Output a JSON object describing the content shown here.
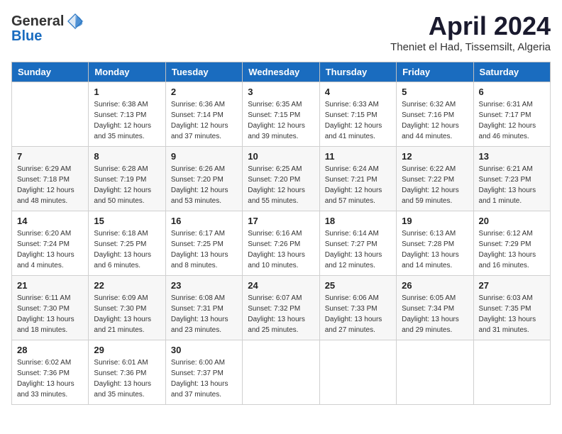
{
  "header": {
    "logo_general": "General",
    "logo_blue": "Blue",
    "month_title": "April 2024",
    "location": "Theniet el Had, Tissemsilt, Algeria"
  },
  "calendar": {
    "days_of_week": [
      "Sunday",
      "Monday",
      "Tuesday",
      "Wednesday",
      "Thursday",
      "Friday",
      "Saturday"
    ],
    "weeks": [
      [
        {
          "day": "",
          "sunrise": "",
          "sunset": "",
          "daylight": ""
        },
        {
          "day": "1",
          "sunrise": "Sunrise: 6:38 AM",
          "sunset": "Sunset: 7:13 PM",
          "daylight": "Daylight: 12 hours and 35 minutes."
        },
        {
          "day": "2",
          "sunrise": "Sunrise: 6:36 AM",
          "sunset": "Sunset: 7:14 PM",
          "daylight": "Daylight: 12 hours and 37 minutes."
        },
        {
          "day": "3",
          "sunrise": "Sunrise: 6:35 AM",
          "sunset": "Sunset: 7:15 PM",
          "daylight": "Daylight: 12 hours and 39 minutes."
        },
        {
          "day": "4",
          "sunrise": "Sunrise: 6:33 AM",
          "sunset": "Sunset: 7:15 PM",
          "daylight": "Daylight: 12 hours and 41 minutes."
        },
        {
          "day": "5",
          "sunrise": "Sunrise: 6:32 AM",
          "sunset": "Sunset: 7:16 PM",
          "daylight": "Daylight: 12 hours and 44 minutes."
        },
        {
          "day": "6",
          "sunrise": "Sunrise: 6:31 AM",
          "sunset": "Sunset: 7:17 PM",
          "daylight": "Daylight: 12 hours and 46 minutes."
        }
      ],
      [
        {
          "day": "7",
          "sunrise": "Sunrise: 6:29 AM",
          "sunset": "Sunset: 7:18 PM",
          "daylight": "Daylight: 12 hours and 48 minutes."
        },
        {
          "day": "8",
          "sunrise": "Sunrise: 6:28 AM",
          "sunset": "Sunset: 7:19 PM",
          "daylight": "Daylight: 12 hours and 50 minutes."
        },
        {
          "day": "9",
          "sunrise": "Sunrise: 6:26 AM",
          "sunset": "Sunset: 7:20 PM",
          "daylight": "Daylight: 12 hours and 53 minutes."
        },
        {
          "day": "10",
          "sunrise": "Sunrise: 6:25 AM",
          "sunset": "Sunset: 7:20 PM",
          "daylight": "Daylight: 12 hours and 55 minutes."
        },
        {
          "day": "11",
          "sunrise": "Sunrise: 6:24 AM",
          "sunset": "Sunset: 7:21 PM",
          "daylight": "Daylight: 12 hours and 57 minutes."
        },
        {
          "day": "12",
          "sunrise": "Sunrise: 6:22 AM",
          "sunset": "Sunset: 7:22 PM",
          "daylight": "Daylight: 12 hours and 59 minutes."
        },
        {
          "day": "13",
          "sunrise": "Sunrise: 6:21 AM",
          "sunset": "Sunset: 7:23 PM",
          "daylight": "Daylight: 13 hours and 1 minute."
        }
      ],
      [
        {
          "day": "14",
          "sunrise": "Sunrise: 6:20 AM",
          "sunset": "Sunset: 7:24 PM",
          "daylight": "Daylight: 13 hours and 4 minutes."
        },
        {
          "day": "15",
          "sunrise": "Sunrise: 6:18 AM",
          "sunset": "Sunset: 7:25 PM",
          "daylight": "Daylight: 13 hours and 6 minutes."
        },
        {
          "day": "16",
          "sunrise": "Sunrise: 6:17 AM",
          "sunset": "Sunset: 7:25 PM",
          "daylight": "Daylight: 13 hours and 8 minutes."
        },
        {
          "day": "17",
          "sunrise": "Sunrise: 6:16 AM",
          "sunset": "Sunset: 7:26 PM",
          "daylight": "Daylight: 13 hours and 10 minutes."
        },
        {
          "day": "18",
          "sunrise": "Sunrise: 6:14 AM",
          "sunset": "Sunset: 7:27 PM",
          "daylight": "Daylight: 13 hours and 12 minutes."
        },
        {
          "day": "19",
          "sunrise": "Sunrise: 6:13 AM",
          "sunset": "Sunset: 7:28 PM",
          "daylight": "Daylight: 13 hours and 14 minutes."
        },
        {
          "day": "20",
          "sunrise": "Sunrise: 6:12 AM",
          "sunset": "Sunset: 7:29 PM",
          "daylight": "Daylight: 13 hours and 16 minutes."
        }
      ],
      [
        {
          "day": "21",
          "sunrise": "Sunrise: 6:11 AM",
          "sunset": "Sunset: 7:30 PM",
          "daylight": "Daylight: 13 hours and 18 minutes."
        },
        {
          "day": "22",
          "sunrise": "Sunrise: 6:09 AM",
          "sunset": "Sunset: 7:30 PM",
          "daylight": "Daylight: 13 hours and 21 minutes."
        },
        {
          "day": "23",
          "sunrise": "Sunrise: 6:08 AM",
          "sunset": "Sunset: 7:31 PM",
          "daylight": "Daylight: 13 hours and 23 minutes."
        },
        {
          "day": "24",
          "sunrise": "Sunrise: 6:07 AM",
          "sunset": "Sunset: 7:32 PM",
          "daylight": "Daylight: 13 hours and 25 minutes."
        },
        {
          "day": "25",
          "sunrise": "Sunrise: 6:06 AM",
          "sunset": "Sunset: 7:33 PM",
          "daylight": "Daylight: 13 hours and 27 minutes."
        },
        {
          "day": "26",
          "sunrise": "Sunrise: 6:05 AM",
          "sunset": "Sunset: 7:34 PM",
          "daylight": "Daylight: 13 hours and 29 minutes."
        },
        {
          "day": "27",
          "sunrise": "Sunrise: 6:03 AM",
          "sunset": "Sunset: 7:35 PM",
          "daylight": "Daylight: 13 hours and 31 minutes."
        }
      ],
      [
        {
          "day": "28",
          "sunrise": "Sunrise: 6:02 AM",
          "sunset": "Sunset: 7:36 PM",
          "daylight": "Daylight: 13 hours and 33 minutes."
        },
        {
          "day": "29",
          "sunrise": "Sunrise: 6:01 AM",
          "sunset": "Sunset: 7:36 PM",
          "daylight": "Daylight: 13 hours and 35 minutes."
        },
        {
          "day": "30",
          "sunrise": "Sunrise: 6:00 AM",
          "sunset": "Sunset: 7:37 PM",
          "daylight": "Daylight: 13 hours and 37 minutes."
        },
        {
          "day": "",
          "sunrise": "",
          "sunset": "",
          "daylight": ""
        },
        {
          "day": "",
          "sunrise": "",
          "sunset": "",
          "daylight": ""
        },
        {
          "day": "",
          "sunrise": "",
          "sunset": "",
          "daylight": ""
        },
        {
          "day": "",
          "sunrise": "",
          "sunset": "",
          "daylight": ""
        }
      ]
    ]
  }
}
